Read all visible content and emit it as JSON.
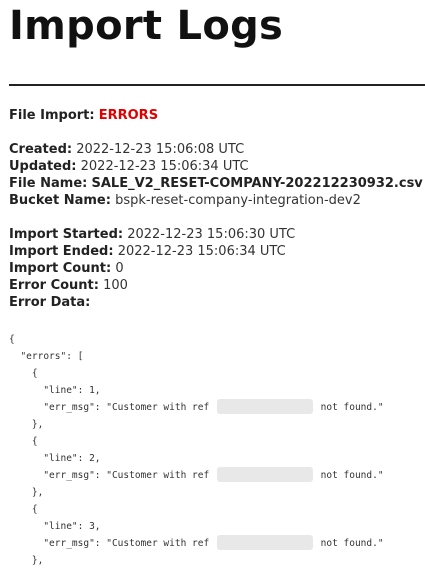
{
  "page": {
    "title": "Import Logs"
  },
  "file_import": {
    "label": "File Import:",
    "status": "ERRORS",
    "status_color": "#e00000"
  },
  "details": {
    "created_label": "Created:",
    "created_value": "2022-12-23 15:06:08 UTC",
    "updated_label": "Updated:",
    "updated_value": "2022-12-23 15:06:34 UTC",
    "file_name_label": "File Name:",
    "file_name_value": "SALE_V2_RESET-COMPANY-202212230932.csv",
    "bucket_name_label": "Bucket Name:",
    "bucket_name_value": "bspk-reset-company-integration-dev2"
  },
  "import": {
    "started_label": "Import Started:",
    "started_value": "2022-12-23 15:06:30 UTC",
    "ended_label": "Import Ended:",
    "ended_value": "2022-12-23 15:06:34 UTC",
    "count_label": "Import Count:",
    "count_value": "0",
    "error_count_label": "Error Count:",
    "error_count_value": "100",
    "error_data_label": "Error Data:"
  },
  "error_json": {
    "open_brace": "{",
    "errors_key": "  \"errors\": [",
    "entries": [
      {
        "open": "    {",
        "line_text": "      \"line\": 1,",
        "msg_prefix": "      \"err_msg\": \"Customer with ref ",
        "msg_suffix": " not found.\"",
        "close": "    },"
      },
      {
        "open": "    {",
        "line_text": "      \"line\": 2,",
        "msg_prefix": "      \"err_msg\": \"Customer with ref ",
        "msg_suffix": " not found.\"",
        "close": "    },"
      },
      {
        "open": "    {",
        "line_text": "      \"line\": 3,",
        "msg_prefix": "      \"err_msg\": \"Customer with ref ",
        "msg_suffix": " not found.\"",
        "close": "    },"
      }
    ]
  }
}
